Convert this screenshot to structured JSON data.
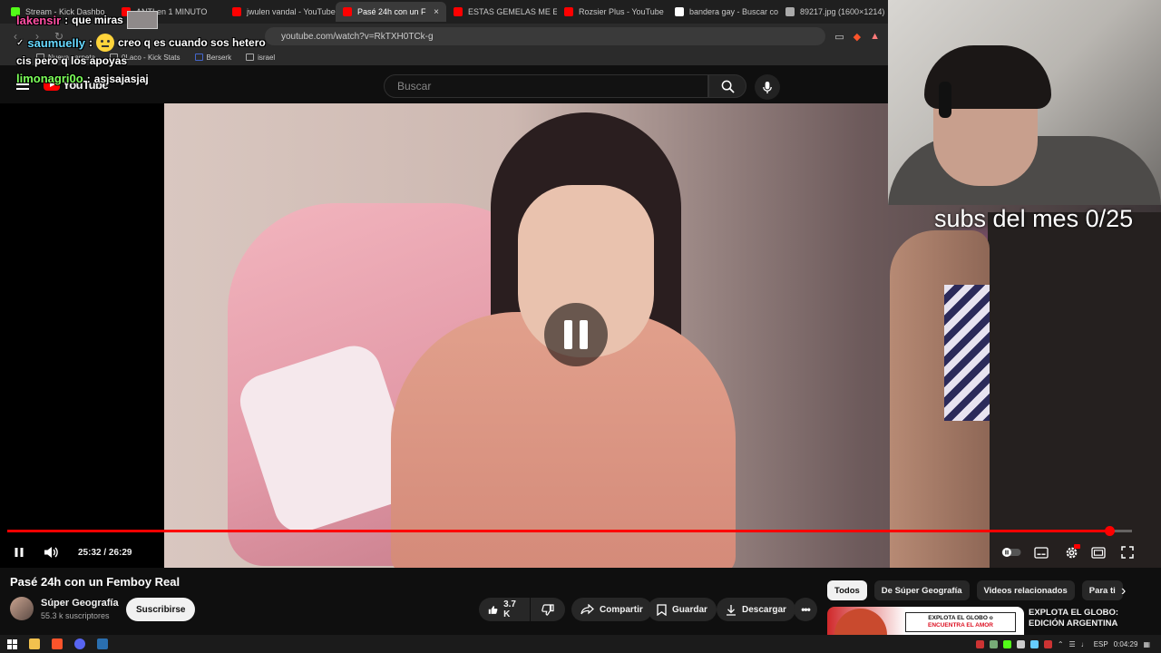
{
  "browser": {
    "tabs": [
      {
        "label": "Stream - Kick Dashbo",
        "color": "#53fc18",
        "active": false
      },
      {
        "label": "ANTI en 1 MINUTO",
        "color": "#ff0000",
        "active": false
      },
      {
        "label": "jwulen vandal - YouTube",
        "color": "#ff0000",
        "active": false
      },
      {
        "label": "Pasé 24h con un F",
        "color": "#ff0000",
        "active": true
      },
      {
        "label": "ESTAS GEMELAS ME ENA",
        "color": "#ff0000",
        "active": false
      },
      {
        "label": "Rozsier Plus - YouTube",
        "color": "#ff0000",
        "active": false
      },
      {
        "label": "bandera gay - Buscar con",
        "color": "#ffffff",
        "active": false
      },
      {
        "label": "89217.jpg (1600×1214)",
        "color": "#aaaaaa",
        "active": false
      }
    ],
    "tab_close": "×",
    "url": "youtube.com/watch?v=RkTXH0TCk-g",
    "bookmarks": [
      "Nueva carpeta",
      "0Laco - Kick Stats",
      "Berserk",
      "israel"
    ]
  },
  "youtube": {
    "logo": "YouTube",
    "search_placeholder": "Buscar"
  },
  "player": {
    "current_time": "25:32",
    "duration": "26:29",
    "time_display": "25:32 / 26:29",
    "progress_fraction": 0.9796
  },
  "chat": [
    {
      "user": "lakensir",
      "user_color": "#ff4fa3",
      "message": "que miras"
    },
    {
      "user": "saumuelly",
      "user_color": "#66d9ff",
      "message": "creo q es cuando sos hetero"
    },
    {
      "user": "",
      "user_color": "#ffffff",
      "message": "cis pero q los apoyas"
    },
    {
      "user": "limonagri0o",
      "user_color": "#7cff5a",
      "message": "asjsajasjaj"
    }
  ],
  "overlay": {
    "subs_goal": "subs del mes 0/25"
  },
  "video": {
    "title": "Pasé 24h con un Femboy Real",
    "channel": "Súper Geografía",
    "subscribers": "55.3 k suscriptores",
    "subscribe_label": "Suscribirse",
    "likes": "3.7 K",
    "share_label": "Compartir",
    "save_label": "Guardar",
    "download_label": "Descargar"
  },
  "sidebar": {
    "chips": [
      "Todos",
      "De Súper Geografía",
      "Videos relacionados",
      "Para ti"
    ],
    "related": {
      "title": "EXPLOTA EL GLOBO: EDICIÓN ARGENTINA",
      "thumb_line1": "EXPLOTA EL GLOBO o",
      "thumb_line2": "ENCUENTRA EL AMOR"
    }
  },
  "taskbar": {
    "language": "ESP",
    "clock": "0:04:29"
  }
}
